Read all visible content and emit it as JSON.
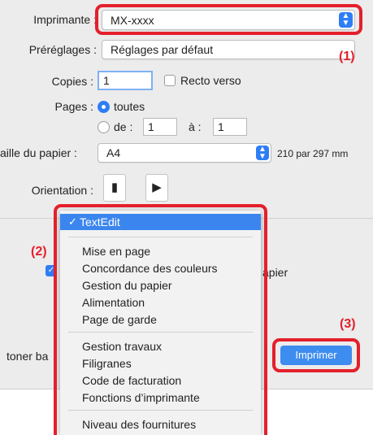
{
  "printer": {
    "label": "Imprimante :",
    "value": "MX-xxxx"
  },
  "presets": {
    "label": "Préréglages :",
    "value": "Réglages par défaut"
  },
  "copies": {
    "label": "Copies :",
    "value": "1",
    "duplex_label": "Recto verso"
  },
  "pages": {
    "label": "Pages :",
    "all_label": "toutes",
    "from_label": "de :",
    "from_value": "1",
    "to_label": "à :",
    "to_value": "1"
  },
  "paper": {
    "label": "aille du papier :",
    "value": "A4",
    "size_text": "210 par 297 mm"
  },
  "orientation": {
    "label": "Orientation :"
  },
  "background": {
    "paper_text": "apier",
    "toner_text": "toner ba"
  },
  "menu": {
    "selected": "TextEdit",
    "group1": [
      "Mise en page",
      "Concordance des couleurs",
      "Gestion du papier",
      "Alimentation",
      "Page de garde"
    ],
    "group2": [
      "Gestion travaux",
      "Filigranes",
      "Code de facturation",
      "Fonctions d’imprimante"
    ],
    "group3": [
      "Niveau des fournitures"
    ]
  },
  "print_button": "Imprimer",
  "callouts": {
    "c1": "(1)",
    "c2": "(2)",
    "c3": "(3)"
  },
  "colors": {
    "accent": "#2f7df6",
    "callout_red": "#e3202c"
  }
}
